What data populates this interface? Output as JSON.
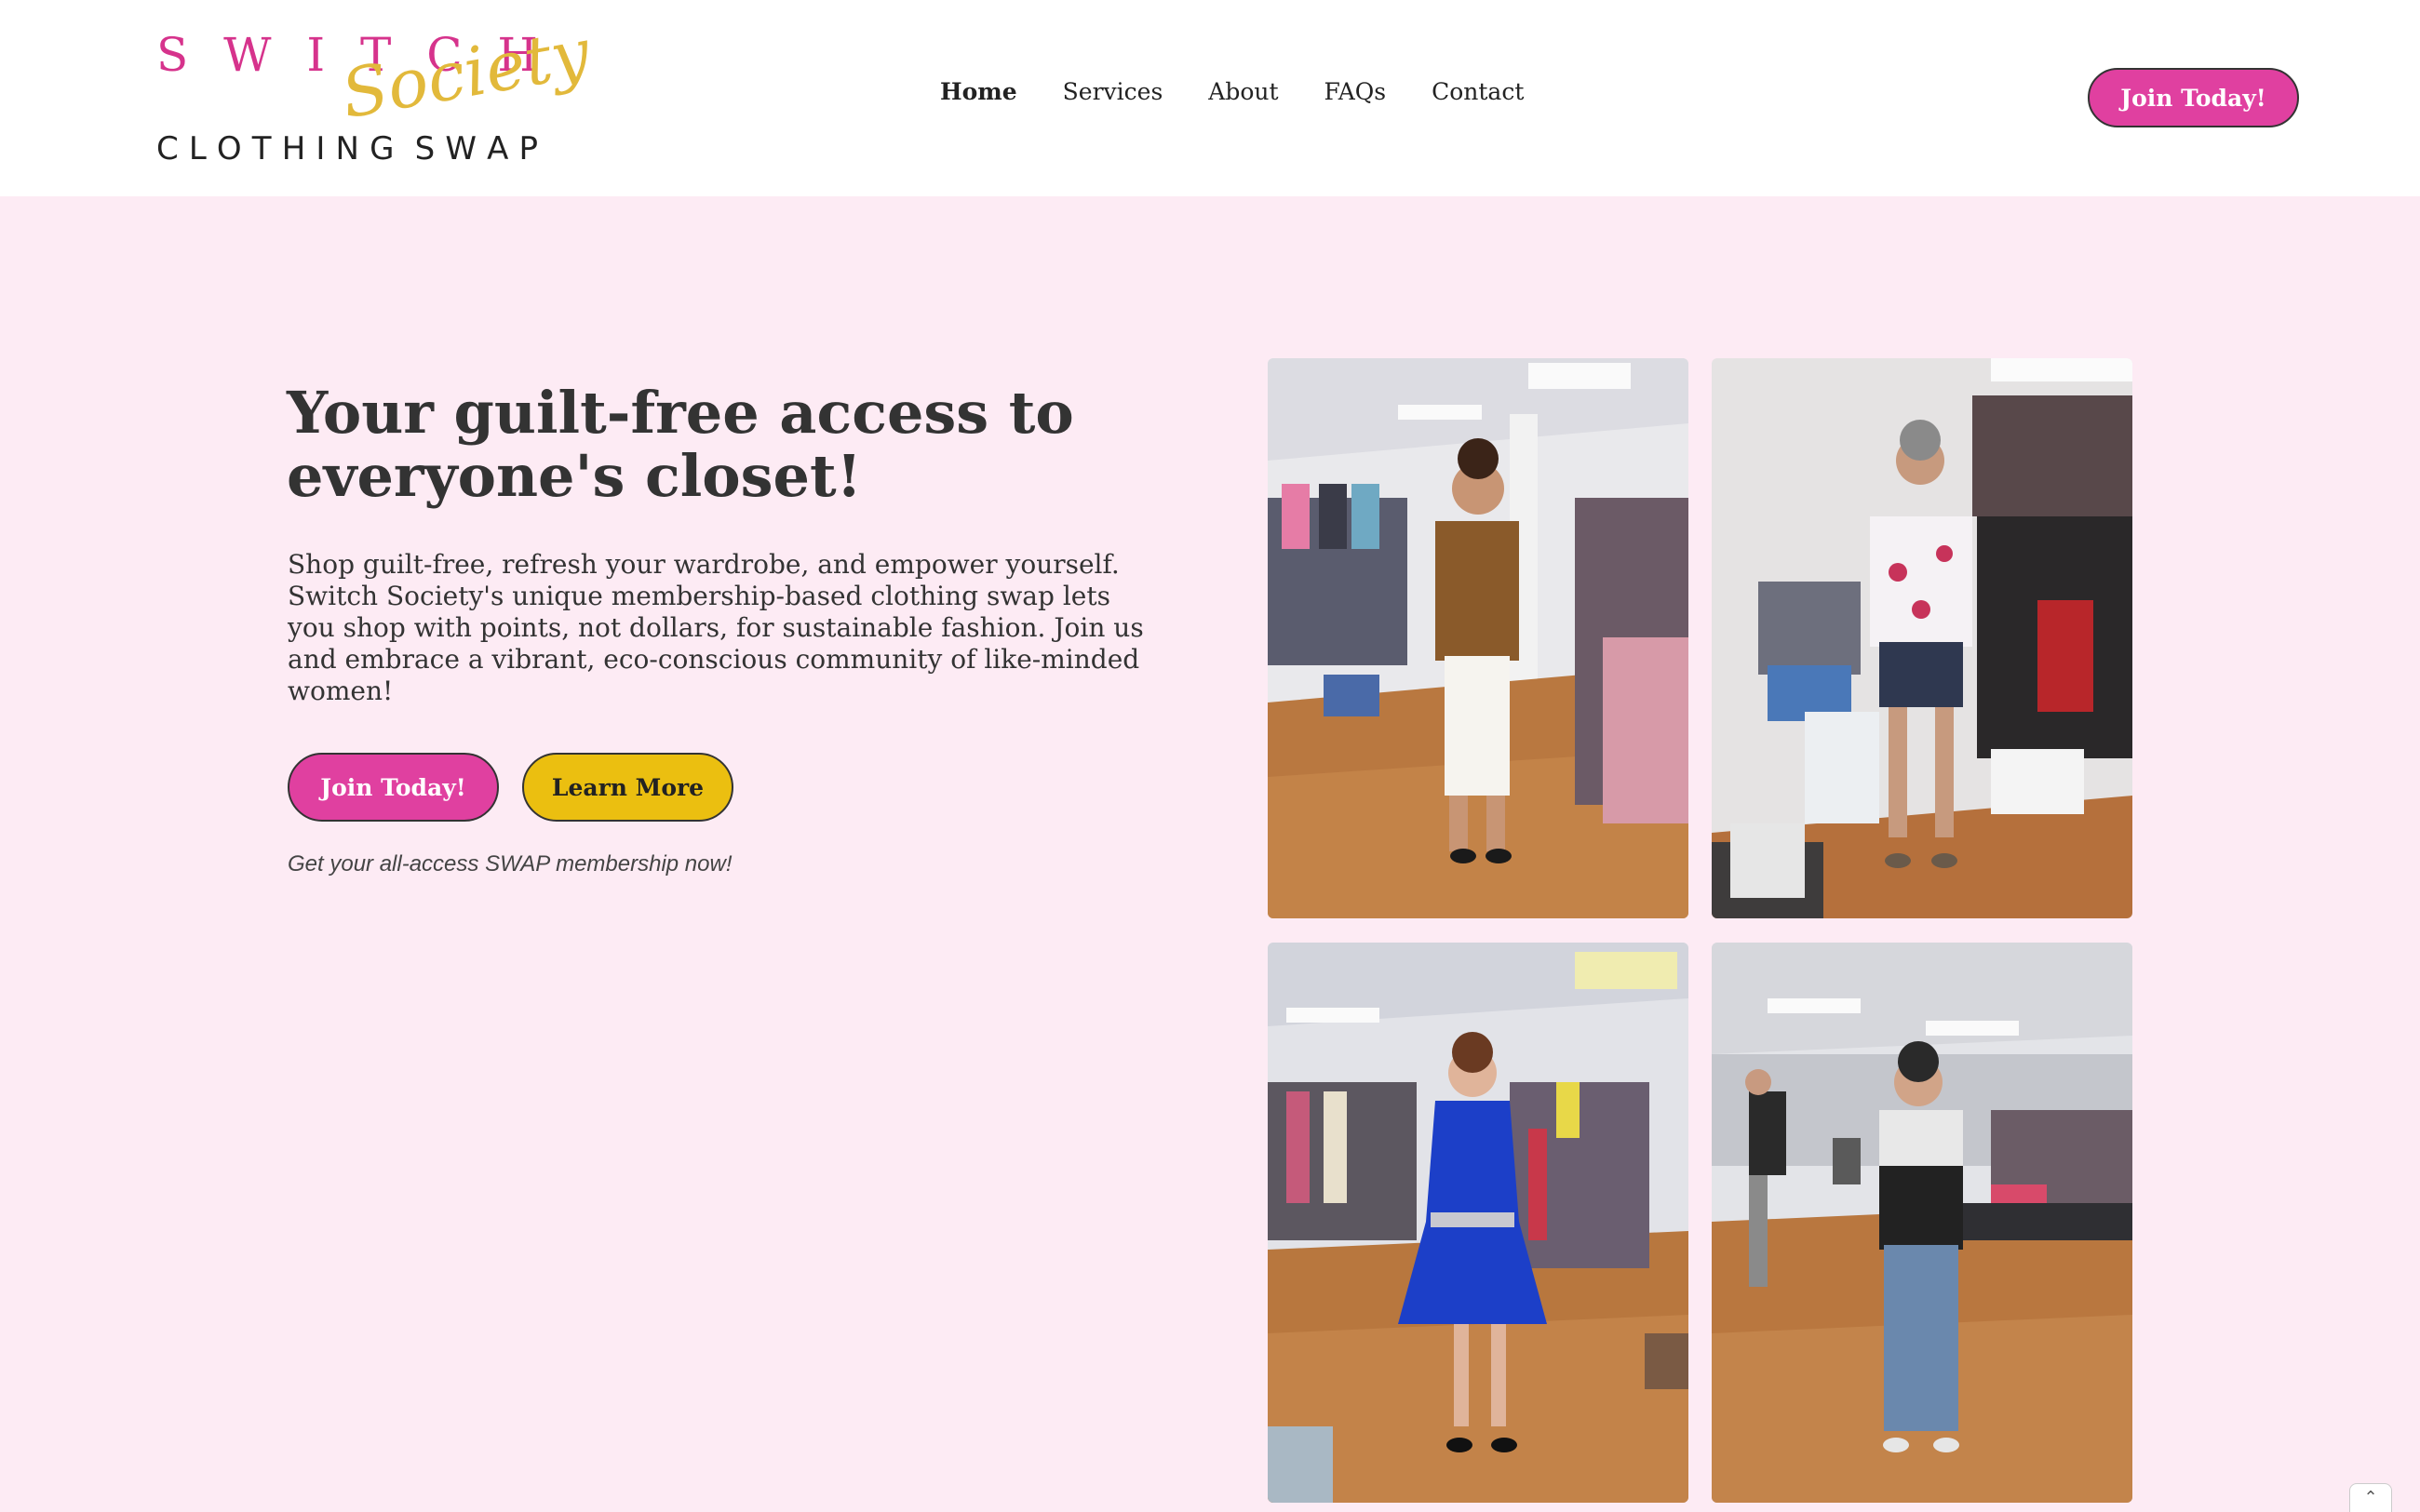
{
  "logo": {
    "top_letters": [
      "S",
      "W",
      "I",
      "T",
      "C",
      "H"
    ],
    "script": "Society",
    "bottom_letters": [
      "C",
      "L",
      "O",
      "T",
      "H",
      "I",
      "N",
      "G",
      " ",
      "S",
      "W",
      "A",
      "P"
    ],
    "colors": {
      "pink": "#d6338c",
      "gold": "#e2b93b"
    }
  },
  "nav": {
    "items": [
      {
        "label": "Home",
        "active": true
      },
      {
        "label": "Services"
      },
      {
        "label": "About"
      },
      {
        "label": "FAQs"
      },
      {
        "label": "Contact"
      }
    ],
    "cta": "Join Today!"
  },
  "hero": {
    "title": "Your guilt-free access to everyone's closet!",
    "text": "Shop guilt-free, refresh your wardrobe, and empower yourself. Switch Society's unique membership-based clothing swap lets you shop with points, not dollars, for sustainable fashion. Join us and embrace a vibrant, eco-conscious community of like-minded women!",
    "join_label": "Join Today!",
    "learn_label": "Learn More",
    "note": "Get your all-access SWAP membership now!"
  },
  "colors": {
    "background": "#fdebf4",
    "accent_pink": "#e040a0",
    "accent_yellow": "#ebbf10"
  },
  "photos": [
    "photo-woman-leopard-top",
    "photo-woman-floral-top",
    "photo-woman-blue-dress",
    "photo-woman-patterned-top"
  ],
  "scroll_top": "⌃"
}
